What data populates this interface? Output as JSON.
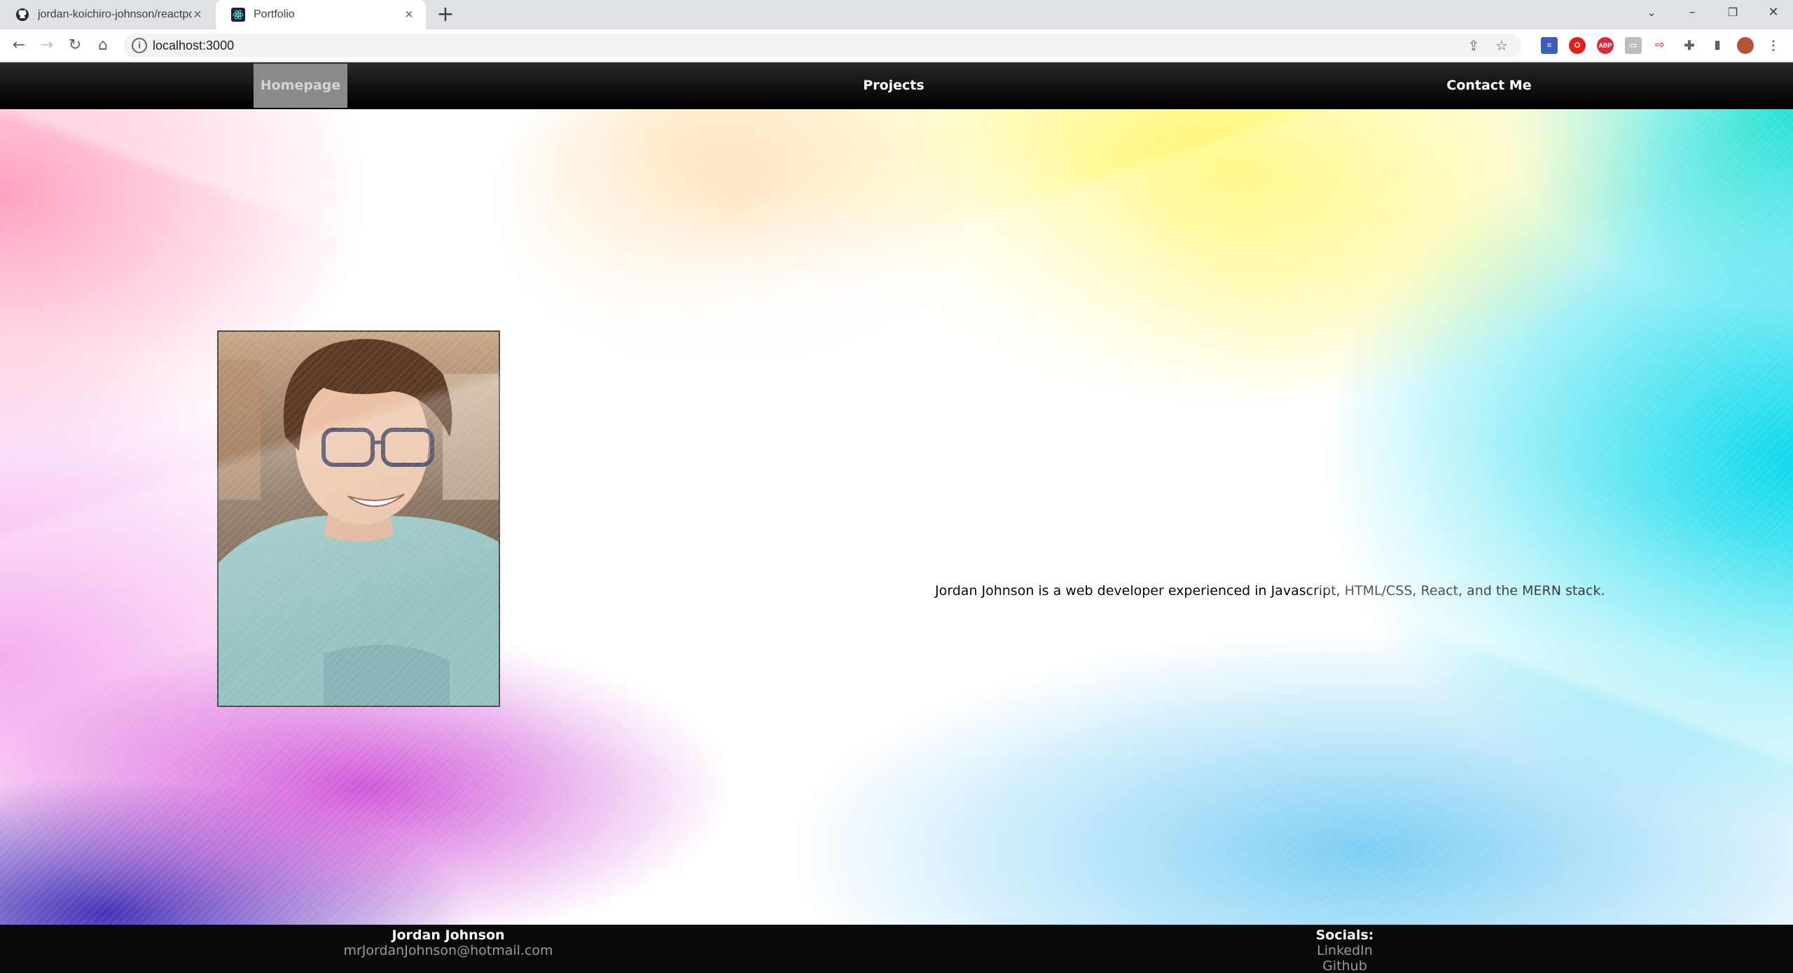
{
  "browser": {
    "tabs": [
      {
        "title": "jordan-koichiro-johnson/reactpo",
        "icon": "github-icon",
        "active": false
      },
      {
        "title": "Portfolio",
        "icon": "react-icon",
        "active": true
      }
    ],
    "address": "localhost:3000"
  },
  "nav": {
    "items": [
      {
        "label": "Homepage",
        "active": true
      },
      {
        "label": "Projects",
        "active": false
      },
      {
        "label": "Contact Me",
        "active": false
      }
    ]
  },
  "main": {
    "intro": "Jordan Johnson is a web developer experienced in Javascript, HTML/CSS, React, and the MERN stack.",
    "photo": "portrait-photo"
  },
  "footer": {
    "name": "Jordan Johnson",
    "email": "mrJordanJohnson@hotmail.com",
    "socials_heading": "Socials:",
    "socials": [
      "LinkedIn",
      "Github"
    ]
  },
  "colors": {
    "nav_bg": "#000000",
    "nav_active_bg": "#8a8a8a",
    "footer_bg": "#0a0a0a",
    "footer_muted": "#9a9a9a"
  }
}
